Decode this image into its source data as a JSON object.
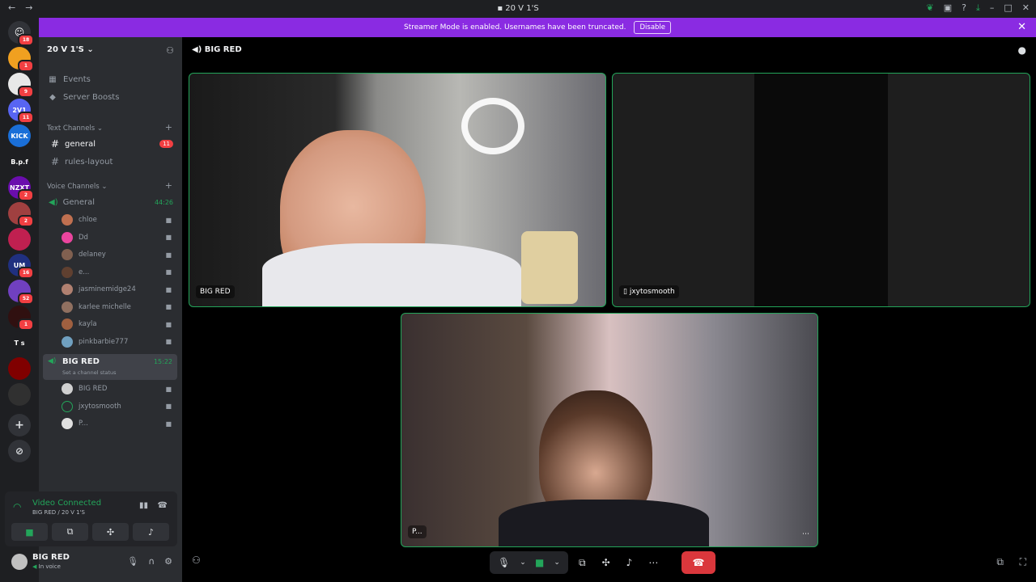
{
  "window": {
    "title": "20 V 1'S",
    "back_icon": "←",
    "forward_icon": "→"
  },
  "banner": {
    "text": "Streamer Mode is enabled. Usernames have been truncated.",
    "button": "Disable"
  },
  "rail": {
    "home_badge": "18",
    "servers": [
      {
        "label": "",
        "badge": "1",
        "color": "#f0a020"
      },
      {
        "label": "",
        "badge": "9",
        "color": "#e8e8e8"
      },
      {
        "label": "2V1",
        "badge": "11",
        "color": "#5865f2"
      },
      {
        "label": "KICK",
        "badge": "",
        "color": "#1a6fd8"
      },
      {
        "label": "B.p.f",
        "badge": "",
        "color": "#1e1f22"
      },
      {
        "label": "NZXT",
        "badge": "2",
        "color": "#6a0dad"
      },
      {
        "label": "",
        "badge": "2",
        "color": "#a04040"
      },
      {
        "label": "",
        "badge": "",
        "color": "#c02050"
      },
      {
        "label": "UM",
        "badge": "16",
        "color": "#203080"
      },
      {
        "label": "",
        "badge": "52",
        "color": "#7040c0"
      },
      {
        "label": "",
        "badge": "1",
        "color": "#301010"
      },
      {
        "label": "T s",
        "badge": "",
        "color": "#1e1f22"
      },
      {
        "label": "",
        "badge": "",
        "color": "#800000"
      },
      {
        "label": "",
        "badge": "",
        "color": "#303030"
      }
    ],
    "add_icon": "+",
    "discover_icon": "⊘"
  },
  "sidebar": {
    "server_name": "20 V 1'S",
    "events": "Events",
    "boosts": "Server Boosts",
    "text_category": "Text Channels",
    "text_channels": [
      {
        "name": "general",
        "badge": "11"
      },
      {
        "name": "rules-layout",
        "badge": ""
      }
    ],
    "voice_category": "Voice Channels",
    "voice_general": {
      "name": "General",
      "timer": "44:26"
    },
    "general_users": [
      {
        "name": "chloe",
        "color": "#c07050"
      },
      {
        "name": "Dd",
        "color": "#eb459e"
      },
      {
        "name": "delaney",
        "color": "#806050"
      },
      {
        "name": "e...",
        "color": "#604030"
      },
      {
        "name": "jasminemidge24",
        "color": "#b08070"
      },
      {
        "name": "karlee michelle",
        "color": "#907060"
      },
      {
        "name": "kayla",
        "color": "#a06040"
      },
      {
        "name": "pinkbarbie777",
        "color": "#70a0c0"
      }
    ],
    "voice_bigred": {
      "name": "BIG RED",
      "timer": "15:22",
      "status": "Set a channel status"
    },
    "bigred_users": [
      {
        "name": "BIG RED",
        "color": "#d0d0d0"
      },
      {
        "name": "jxytosmooth",
        "color": "#2b2d31"
      },
      {
        "name": "P...",
        "color": "#e0e0e0"
      }
    ]
  },
  "voice_panel": {
    "title": "Video Connected",
    "subtitle": "BIG RED / 20 V 1'S"
  },
  "user": {
    "name": "BIG RED",
    "status": "In voice"
  },
  "main": {
    "channel": "BIG RED",
    "tiles": [
      {
        "label": "BIG RED"
      },
      {
        "label": "jxytosmooth"
      },
      {
        "label": "P..."
      }
    ]
  },
  "colors": {
    "accent": "#5865f2",
    "green": "#23a55a",
    "danger": "#da373c",
    "banner": "#8a2be2"
  }
}
